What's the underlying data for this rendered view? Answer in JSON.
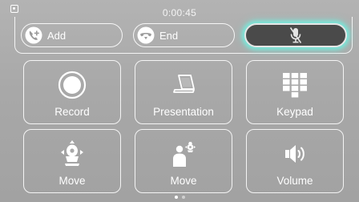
{
  "status_bar": {
    "timer": "0:00:45",
    "status_icon": "contact-card-icon"
  },
  "call_controls": {
    "add_label": "Add",
    "add_icon": "add-call-handset-icon",
    "end_label": "End",
    "end_icon": "hang-up-handset-icon",
    "mute_icon": "microphone-muted-icon",
    "mute_state": "muted",
    "glow_color": "#78e8da"
  },
  "tiles": [
    {
      "label": "Record",
      "icon": "record-icon"
    },
    {
      "label": "Presentation",
      "icon": "laptop-icon"
    },
    {
      "label": "Keypad",
      "icon": "keypad-grid-icon"
    },
    {
      "label": "Move",
      "icon": "camera-move-icon"
    },
    {
      "label": "Move",
      "icon": "presenter-move-icon"
    },
    {
      "label": "Volume",
      "icon": "speaker-volume-icon"
    }
  ],
  "pagination": {
    "page_count": 2,
    "active_page": 1
  }
}
